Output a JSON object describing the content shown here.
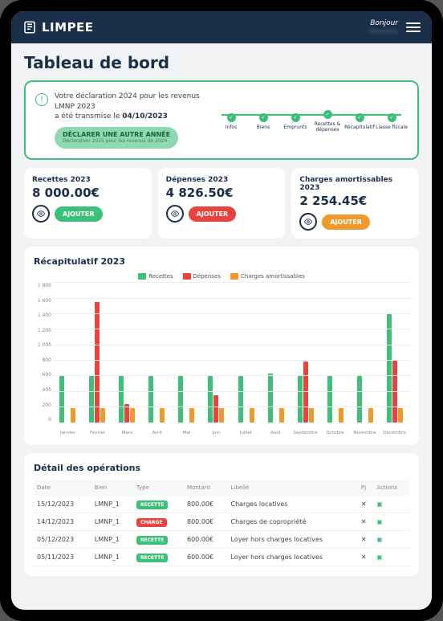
{
  "brand": "LIMPEE",
  "greeting": "Bonjour",
  "username": "————",
  "page_title": "Tableau de bord",
  "declaration": {
    "line1": "Votre déclaration 2024 pour les revenus LMNP 2023",
    "line2_prefix": "a été transmise le ",
    "date": "04/10/2023",
    "button": "DÉCLARER UNE AUTRE ANNÉE",
    "button_sub": "Déclaration 2025 pour les revenus de 2024"
  },
  "steps": [
    "Infos",
    "Biens",
    "Emprunts",
    "Recettes & dépenses",
    "Récapitulatif",
    "Liasse fiscale"
  ],
  "kpis": [
    {
      "title": "Recettes 2023",
      "value": "8 000.00€",
      "color": "green"
    },
    {
      "title": "Dépenses 2023",
      "value": "4 826.50€",
      "color": "red"
    },
    {
      "title": "Charges amortissables 2023",
      "value": "2 254.45€",
      "color": "orange"
    }
  ],
  "kpi_add_label": "AJOUTER",
  "recap_title": "Récapitulatif 2023",
  "legend": [
    "Recettes",
    "Dépenses",
    "Charges amortissables"
  ],
  "detail_title": "Détail des opérations",
  "columns": [
    "Date",
    "Bien",
    "Type",
    "Montant",
    "Libellé",
    "Pj",
    "Actions"
  ],
  "type_labels": {
    "recette": "RECETTE",
    "charge": "CHARGE"
  },
  "rows": [
    {
      "date": "15/12/2023",
      "bien": "LMNP_1",
      "type": "recette",
      "montant": "800.00€",
      "libelle": "Charges locatives"
    },
    {
      "date": "14/12/2023",
      "bien": "LMNP_1",
      "type": "charge",
      "montant": "800.00€",
      "libelle": "Charges de copropriété"
    },
    {
      "date": "05/12/2023",
      "bien": "LMNP_1",
      "type": "recette",
      "montant": "600.00€",
      "libelle": "Loyer hors charges locatives"
    },
    {
      "date": "05/11/2023",
      "bien": "LMNP_1",
      "type": "recette",
      "montant": "600.00€",
      "libelle": "Loyer hors charges locatives"
    }
  ],
  "chart_data": {
    "type": "bar",
    "title": "Récapitulatif 2023",
    "ylabel": "",
    "xlabel": "",
    "ylim": [
      0,
      1800
    ],
    "yticks": [
      0,
      200,
      400,
      600,
      800,
      1000,
      1200,
      1400,
      1600,
      1800
    ],
    "categories": [
      "Janvier",
      "Février",
      "Mars",
      "Avril",
      "Mai",
      "Juin",
      "Juillet",
      "Août",
      "Septembre",
      "Octobre",
      "Novembre",
      "Décembre"
    ],
    "series": [
      {
        "name": "Recettes",
        "color": "#3dc07a",
        "values": [
          600,
          600,
          600,
          600,
          600,
          600,
          600,
          630,
          600,
          600,
          600,
          1400
        ]
      },
      {
        "name": "Dépenses",
        "color": "#e8443d",
        "values": [
          0,
          1550,
          240,
          0,
          0,
          350,
          0,
          0,
          790,
          0,
          0,
          800
        ]
      },
      {
        "name": "Charges amortissables",
        "color": "#f09a2e",
        "values": [
          190,
          190,
          190,
          190,
          190,
          190,
          190,
          190,
          190,
          190,
          190,
          190
        ]
      }
    ]
  }
}
